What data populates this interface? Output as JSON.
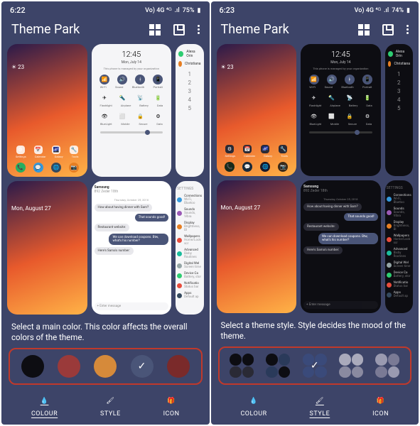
{
  "left": {
    "status": {
      "time": "6:22",
      "net": "Vo) 4G ⁴ᴳ",
      "battery": "75%"
    },
    "title": "Theme Park",
    "previews": {
      "home": {
        "temp": "23",
        "icons_top": [
          "Settings",
          "Calendar",
          "Galaxy",
          "Tools"
        ],
        "icons_bot": [
          "📞",
          "💬",
          "🌐",
          "📷"
        ]
      },
      "qs": {
        "clock": "12:45",
        "date": "Mon, July 14",
        "note": "This phone is managed by your organization",
        "row1": [
          "📶",
          "🔊",
          "ᚼ",
          "📱"
        ],
        "lbl1": [
          "Wi-Fi",
          "Sound",
          "Bluetooth",
          "Portrait"
        ],
        "row2": [
          "✈",
          "🔦",
          "📡",
          "🔋"
        ],
        "lbl2": [
          "Flashlight",
          "Airplane",
          "Battery",
          "Data"
        ],
        "row3": [
          "👁",
          "⬜",
          "🔒",
          "⚙"
        ],
        "lbl3": [
          "BlueLight",
          "Mobile",
          "Secure",
          "Data"
        ]
      },
      "dialer": {
        "contacts": [
          {
            "c": "#2ecc71",
            "n": "Alexa Orin"
          },
          {
            "c": "#e67e22",
            "n": "Christiana"
          }
        ],
        "pad": [
          "1",
          "2",
          "3",
          "4",
          "5"
        ]
      },
      "lock": {
        "date": "Mon, August 27"
      },
      "msg": {
        "name": "Samsung",
        "sub": "892 Zeder 18th",
        "date": "Thursday, October 25, 2018",
        "bubbles": [
          {
            "t": "rx",
            "x": "How about having dinner with Sam?"
          },
          {
            "t": "tx",
            "x": "That sounds good!"
          },
          {
            "t": "rx",
            "x": "Restaurant website:"
          },
          {
            "t": "tx",
            "x": "We can download coupons. Btw, what's his number?"
          },
          {
            "t": "rx",
            "x": "Here's Sama's number:"
          }
        ],
        "input": "+ Enter message"
      },
      "settings": {
        "hdr": "SETTINGS",
        "rows": [
          {
            "c": "#3498db",
            "t": "Connections",
            "s": "Wi-Fi, Bluetoo"
          },
          {
            "c": "#9b59b6",
            "t": "Sounds",
            "s": "Sounds, Vibra"
          },
          {
            "c": "#e67e22",
            "t": "Display",
            "s": "Brightness, Bl"
          },
          {
            "c": "#e74c3c",
            "t": "Wallpapers",
            "s": "Home/Lock scr"
          },
          {
            "c": "#1abc9c",
            "t": "Advanced",
            "s": "Bixby Routines"
          },
          {
            "c": "#95a5a6",
            "t": "Digital Wel",
            "s": "Screen time"
          },
          {
            "c": "#2ecc71",
            "t": "Device Ca",
            "s": "Battery, stor"
          },
          {
            "c": "#e74c3c",
            "t": "Notificatio",
            "s": "Status bar"
          },
          {
            "c": "#34495e",
            "t": "Apps",
            "s": "Default ap"
          }
        ]
      }
    },
    "instruction": "Select a main color. This color affects the overall colors of the theme.",
    "swatches": [
      {
        "bg": "#0d0d12"
      },
      {
        "bg": "#9a3a3a"
      },
      {
        "bg": "#d68a3a"
      },
      {
        "bg": "#4a5578",
        "sel": true
      },
      {
        "bg": "#7a2a2a"
      }
    ],
    "tabs": {
      "colour": "COLOUR",
      "style": "STYLE",
      "icon": "ICON",
      "active": "colour"
    }
  },
  "right": {
    "status": {
      "time": "6:23",
      "net": "Vo) 4G ⁴ᴳ",
      "battery": "74%"
    },
    "title": "Theme Park",
    "instruction": "Select a theme style. Style decides the mood of the theme.",
    "swatches": [
      {
        "q": [
          "#0d0d12",
          "#0d0d12",
          "#2a2a35",
          "#2a2a35"
        ]
      },
      {
        "q": [
          "#0d0d12",
          "#2a3a5a",
          "#2a3a5a",
          "#0d0d12"
        ]
      },
      {
        "q": [
          "#3a4a7a",
          "#3a4a7a",
          "#3a4a7a",
          "#3a4a7a"
        ],
        "sel": true
      },
      {
        "q": [
          "#aab",
          "#aab",
          "#8a8aa0",
          "#8a8aa0"
        ]
      },
      {
        "q": [
          "#9a9ab0",
          "#7a7a95",
          "#7a7a95",
          "#9a9ab0"
        ]
      }
    ],
    "tabs": {
      "colour": "COLOUR",
      "style": "STYLE",
      "icon": "ICON",
      "active": "style"
    }
  }
}
